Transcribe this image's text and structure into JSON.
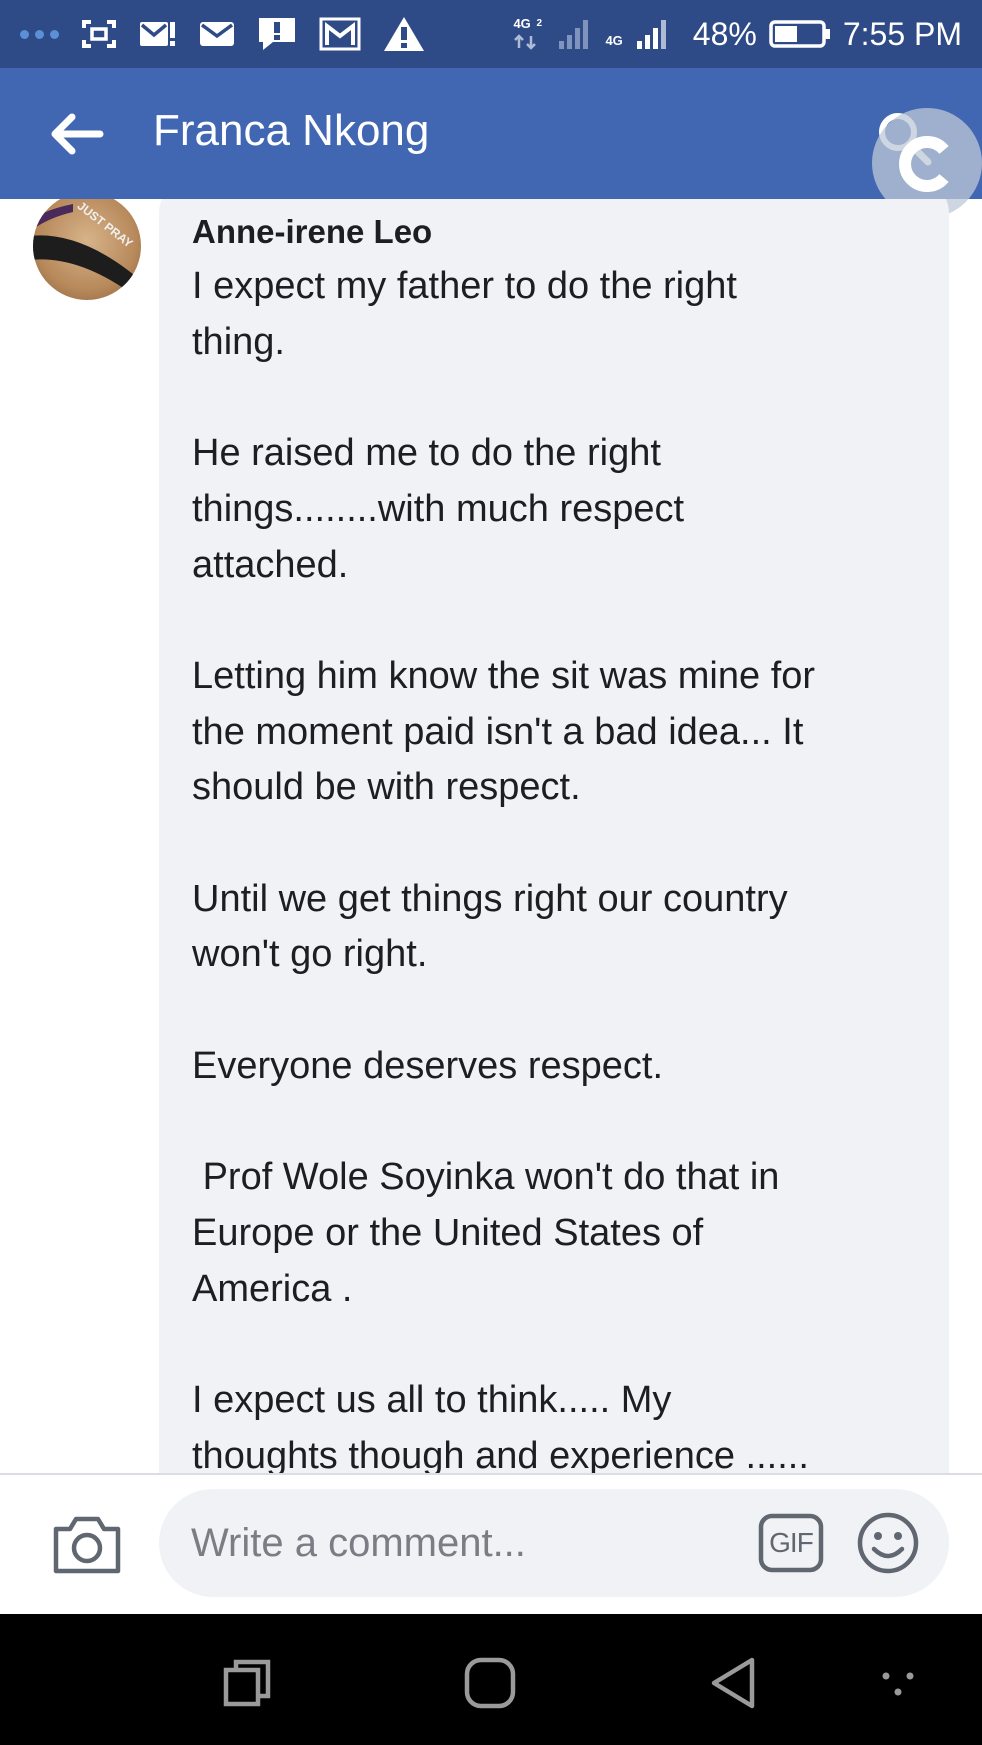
{
  "status_bar": {
    "network_badge": "4G",
    "network_badge_sub": "2",
    "network_label": "4G",
    "battery": "48%",
    "time": "7:55 PM",
    "icons": [
      "notification-dots-icon",
      "screenshot-icon",
      "gmail-icon",
      "mail-icon",
      "message-alert-icon",
      "gmail-outline-icon",
      "warning-icon",
      "data-arrows-icon",
      "signal-icon",
      "signal-icon",
      "battery-icon"
    ]
  },
  "header": {
    "title": "Franca Nkong",
    "icons": [
      "back-arrow-icon",
      "search-icon",
      "refresh-icon"
    ],
    "color": "#4267b2"
  },
  "comment": {
    "author": "Anne-irene Leo",
    "avatar_text": "JUST PRAY",
    "lines": [
      "I expect my father to do the right",
      "thing.",
      "",
      "He raised me to do the right",
      "things........with much respect",
      "attached.",
      "",
      "Letting him know the sit was mine for",
      "the moment paid isn't a bad idea... It",
      "should be with respect.",
      "",
      "Until we get things right our country",
      "won't go right.",
      "",
      "Everyone deserves respect.",
      "",
      " Prof Wole Soyinka won't do that in",
      "Europe or the United States of",
      "America .",
      "",
      "I expect us all to think..... My",
      "thoughts though and experience ......"
    ]
  },
  "composer": {
    "placeholder": "Write a comment...",
    "gif_label": "GIF",
    "icons": [
      "camera-icon",
      "gif-icon",
      "emoji-icon"
    ]
  },
  "nav_bar": {
    "icons": [
      "recent-apps-icon",
      "home-icon",
      "back-icon",
      "more-icon"
    ]
  }
}
